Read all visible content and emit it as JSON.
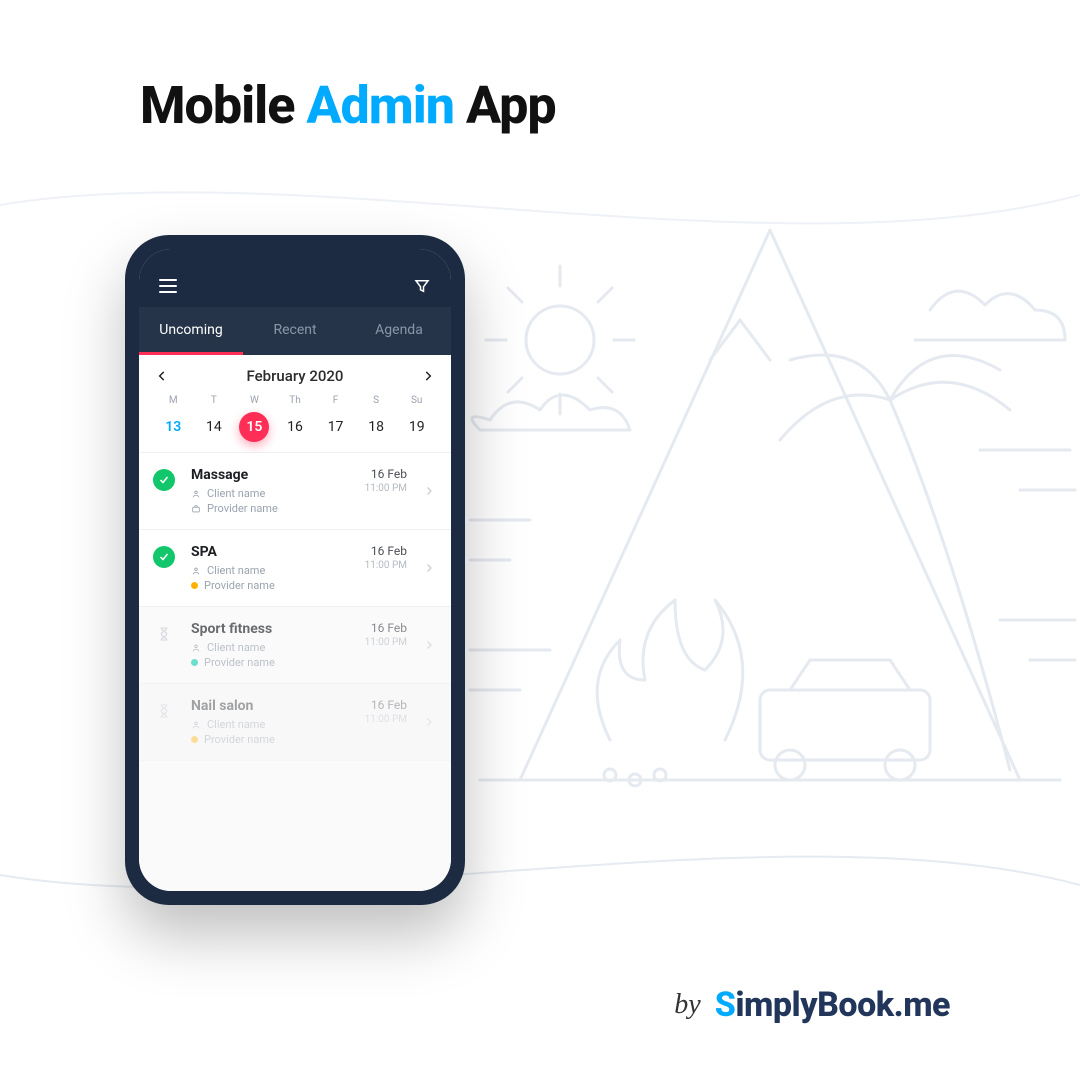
{
  "header": {
    "pre": "Mobile ",
    "accent": "Admin",
    "post": " App"
  },
  "topbar": {
    "menu_icon": "hamburger-icon",
    "filter_icon": "filter-icon"
  },
  "tabs": [
    {
      "label": "Uncoming",
      "active": true
    },
    {
      "label": "Recent",
      "active": false
    },
    {
      "label": "Agenda",
      "active": false
    }
  ],
  "calendar": {
    "title": "February 2020",
    "day_labels": [
      "M",
      "T",
      "W",
      "Th",
      "F",
      "S",
      "Su"
    ],
    "dates": [
      {
        "n": "13",
        "today": true
      },
      {
        "n": "14"
      },
      {
        "n": "15",
        "selected": true
      },
      {
        "n": "16"
      },
      {
        "n": "17"
      },
      {
        "n": "18"
      },
      {
        "n": "19"
      }
    ]
  },
  "appointments": [
    {
      "title": "Massage",
      "client": "Client name",
      "provider": "Provider name",
      "provider_dot": "none",
      "provider_icon": "briefcase",
      "date": "16 Feb",
      "time": "11:00 PM",
      "status": "ok"
    },
    {
      "title": "SPA",
      "client": "Client name",
      "provider": "Provider name",
      "provider_dot": "yellow",
      "date": "16 Feb",
      "time": "11:00 PM",
      "status": "ok"
    },
    {
      "title": "Sport fitness",
      "client": "Client name",
      "provider": "Provider name",
      "provider_dot": "teal",
      "date": "16 Feb",
      "time": "11:00 PM",
      "status": "wait",
      "dim": true
    },
    {
      "title": "Nail salon",
      "client": "Client name",
      "provider": "Provider name",
      "provider_dot": "yellow",
      "date": "16 Feb",
      "time": "11:00 PM",
      "status": "wait",
      "faded": true
    }
  ],
  "footer": {
    "by": "by",
    "brand_s": "S",
    "brand_mid": "implyBook",
    "brand_dot": ".",
    "brand_me": "me"
  }
}
